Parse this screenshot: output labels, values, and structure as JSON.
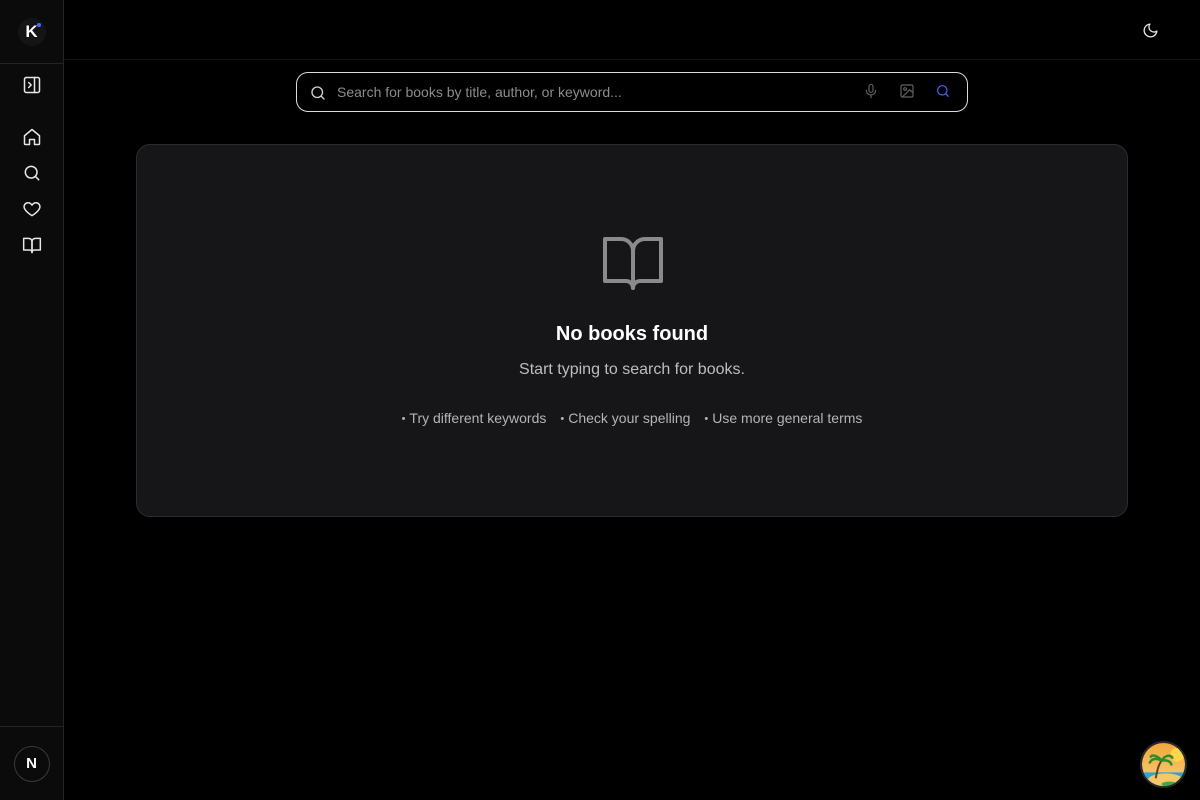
{
  "brand": {
    "logo_letter": "K",
    "accent": "#4f6bff"
  },
  "sidebar": {
    "items": [
      {
        "name": "toggle-sidebar",
        "icon": "panel-right-icon"
      },
      {
        "name": "home",
        "icon": "home-icon"
      },
      {
        "name": "search",
        "icon": "search-icon"
      },
      {
        "name": "favorites",
        "icon": "heart-icon"
      },
      {
        "name": "library",
        "icon": "book-open-icon"
      }
    ],
    "user_initial": "N"
  },
  "topbar": {
    "theme_icon": "moon-icon"
  },
  "search": {
    "placeholder": "Search for books by title, author, or keyword...",
    "value": "",
    "buttons": [
      "mic-icon",
      "image-icon",
      "search-icon"
    ]
  },
  "empty_state": {
    "icon": "book-open-icon",
    "title": "No books found",
    "subtitle": "Start typing to search for books.",
    "tips": [
      "Try different keywords",
      "Check your spelling",
      "Use more general terms"
    ]
  },
  "colors": {
    "background": "#000000",
    "panel": "#161618",
    "search_accent": "#4c63ff"
  }
}
